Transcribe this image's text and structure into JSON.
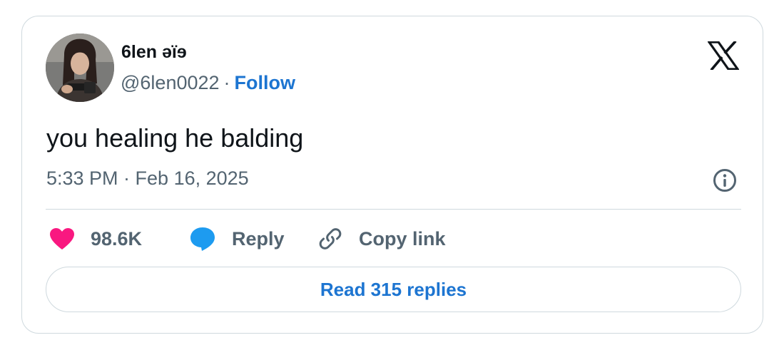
{
  "author": {
    "display_name": "6len əïɘ",
    "handle": "@6len0022",
    "separator": "·",
    "follow_label": "Follow",
    "avatar_icon": "user-avatar-photo"
  },
  "platform": {
    "logo_icon": "x-logo-icon"
  },
  "tweet": {
    "text": "you healing he balding",
    "timestamp": "5:33 PM · Feb 16, 2025"
  },
  "actions": {
    "like_count": "98.6K",
    "reply_label": "Reply",
    "copy_link_label": "Copy link"
  },
  "footer": {
    "read_replies_label": "Read 315 replies"
  },
  "colors": {
    "accent": "#1d75d1",
    "like": "#f91880",
    "reply_bubble": "#1d9bf0",
    "text_primary": "#0f1419",
    "text_secondary": "#536471",
    "border": "#cfd9de"
  }
}
